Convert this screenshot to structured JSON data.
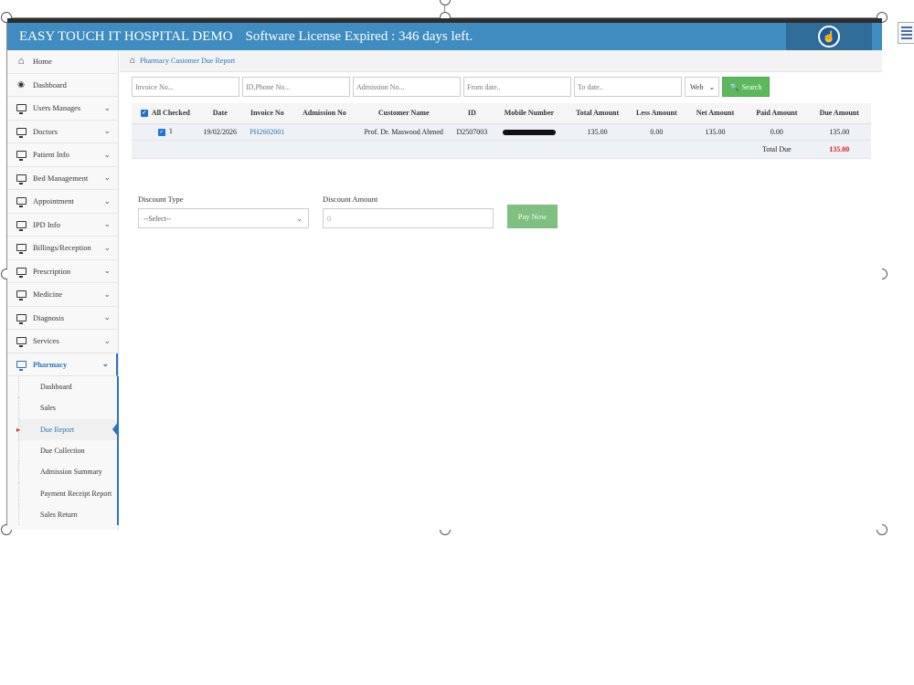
{
  "header": {
    "title": "EASY TOUCH IT HOSPITAL DEMO",
    "license": "Software License Expired : 346 days left."
  },
  "sidebar": {
    "items": [
      {
        "label": "Home",
        "icon": "home-icon",
        "expandable": false
      },
      {
        "label": "Dashboard",
        "icon": "dashboard-icon",
        "expandable": false
      },
      {
        "label": "Users Manages",
        "icon": "monitor-icon",
        "expandable": true
      },
      {
        "label": "Doctors",
        "icon": "monitor-icon",
        "expandable": true
      },
      {
        "label": "Patient Info",
        "icon": "monitor-icon",
        "expandable": true
      },
      {
        "label": "Bed Management",
        "icon": "monitor-icon",
        "expandable": true
      },
      {
        "label": "Appointment",
        "icon": "monitor-icon",
        "expandable": true
      },
      {
        "label": "IPD Info",
        "icon": "monitor-icon",
        "expandable": true
      },
      {
        "label": "Billings/Reception",
        "icon": "monitor-icon",
        "expandable": true
      },
      {
        "label": "Prescription",
        "icon": "monitor-icon",
        "expandable": true
      },
      {
        "label": "Medicine",
        "icon": "monitor-icon",
        "expandable": true
      },
      {
        "label": "Diagnosis",
        "icon": "monitor-icon",
        "expandable": true
      },
      {
        "label": "Services",
        "icon": "monitor-icon",
        "expandable": true
      },
      {
        "label": "Pharmacy",
        "icon": "monitor-icon",
        "expandable": true
      }
    ],
    "pharmacy_sub": [
      "Dashboard",
      "Sales",
      "Due Report",
      "Due Collection",
      "Admission Summary",
      "Payment Receipt Report",
      "Sales Return"
    ],
    "current_sub": "Due Report"
  },
  "breadcrumb": "Pharmacy Customer Due Report",
  "filters": {
    "invoice_placeholder": "Invoice No...",
    "id_phone_placeholder": "ID,Phone No...",
    "admission_placeholder": "Admission No...",
    "from_date_placeholder": "From date..",
    "to_date_placeholder": "To date..",
    "source": "Web",
    "search_label": "Search"
  },
  "table": {
    "all_checked_label": "All Checked",
    "headers": [
      "Date",
      "Invoice No",
      "Admission No",
      "Customer Name",
      "ID",
      "Mobile Number",
      "Total Amount",
      "Less Amount",
      "Net Amount",
      "Paid Amount",
      "Due Amount"
    ],
    "row": {
      "serial": "1",
      "date": "19/02/2026",
      "invoice": "PH2602001",
      "admission": "",
      "customer": "Prof. Dr. Maswood Ahmed",
      "id": "D2507003",
      "total": "135.00",
      "less": "0.00",
      "net": "135.00",
      "paid": "0.00",
      "due": "135.00"
    },
    "total_due_label": "Total Due",
    "total_due_value": "135.00"
  },
  "payment": {
    "discount_type_label": "Discount Type",
    "discount_type_value": "--Select--",
    "discount_amount_label": "Discount Amount",
    "discount_amount_placeholder": "0",
    "pay_now_label": "Pay Now"
  },
  "colors": {
    "header_blue": "#3f8cc0",
    "accent_blue": "#2a75b8",
    "success_green": "#5cb85c",
    "due_red": "#e21b1b"
  }
}
